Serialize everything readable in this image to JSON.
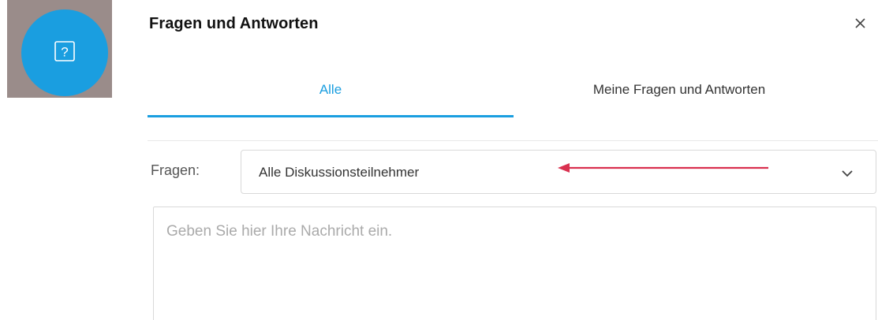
{
  "qa_icon": {
    "name": "question-icon",
    "glyph": "?",
    "color": "#1a9ee0"
  },
  "panel": {
    "title": "Fragen und Antworten",
    "close_glyph": "×"
  },
  "tabs": [
    {
      "label": "Alle",
      "active": true
    },
    {
      "label": "Meine Fragen und Antworten",
      "active": false
    }
  ],
  "filter": {
    "label": "Fragen:",
    "selected": "Alle Diskussionsteilnehmer"
  },
  "message": {
    "placeholder": "Geben Sie hier Ihre Nachricht ein.",
    "value": ""
  },
  "colors": {
    "accent": "#1a9ee0",
    "annotation_arrow": "#d9304f"
  }
}
